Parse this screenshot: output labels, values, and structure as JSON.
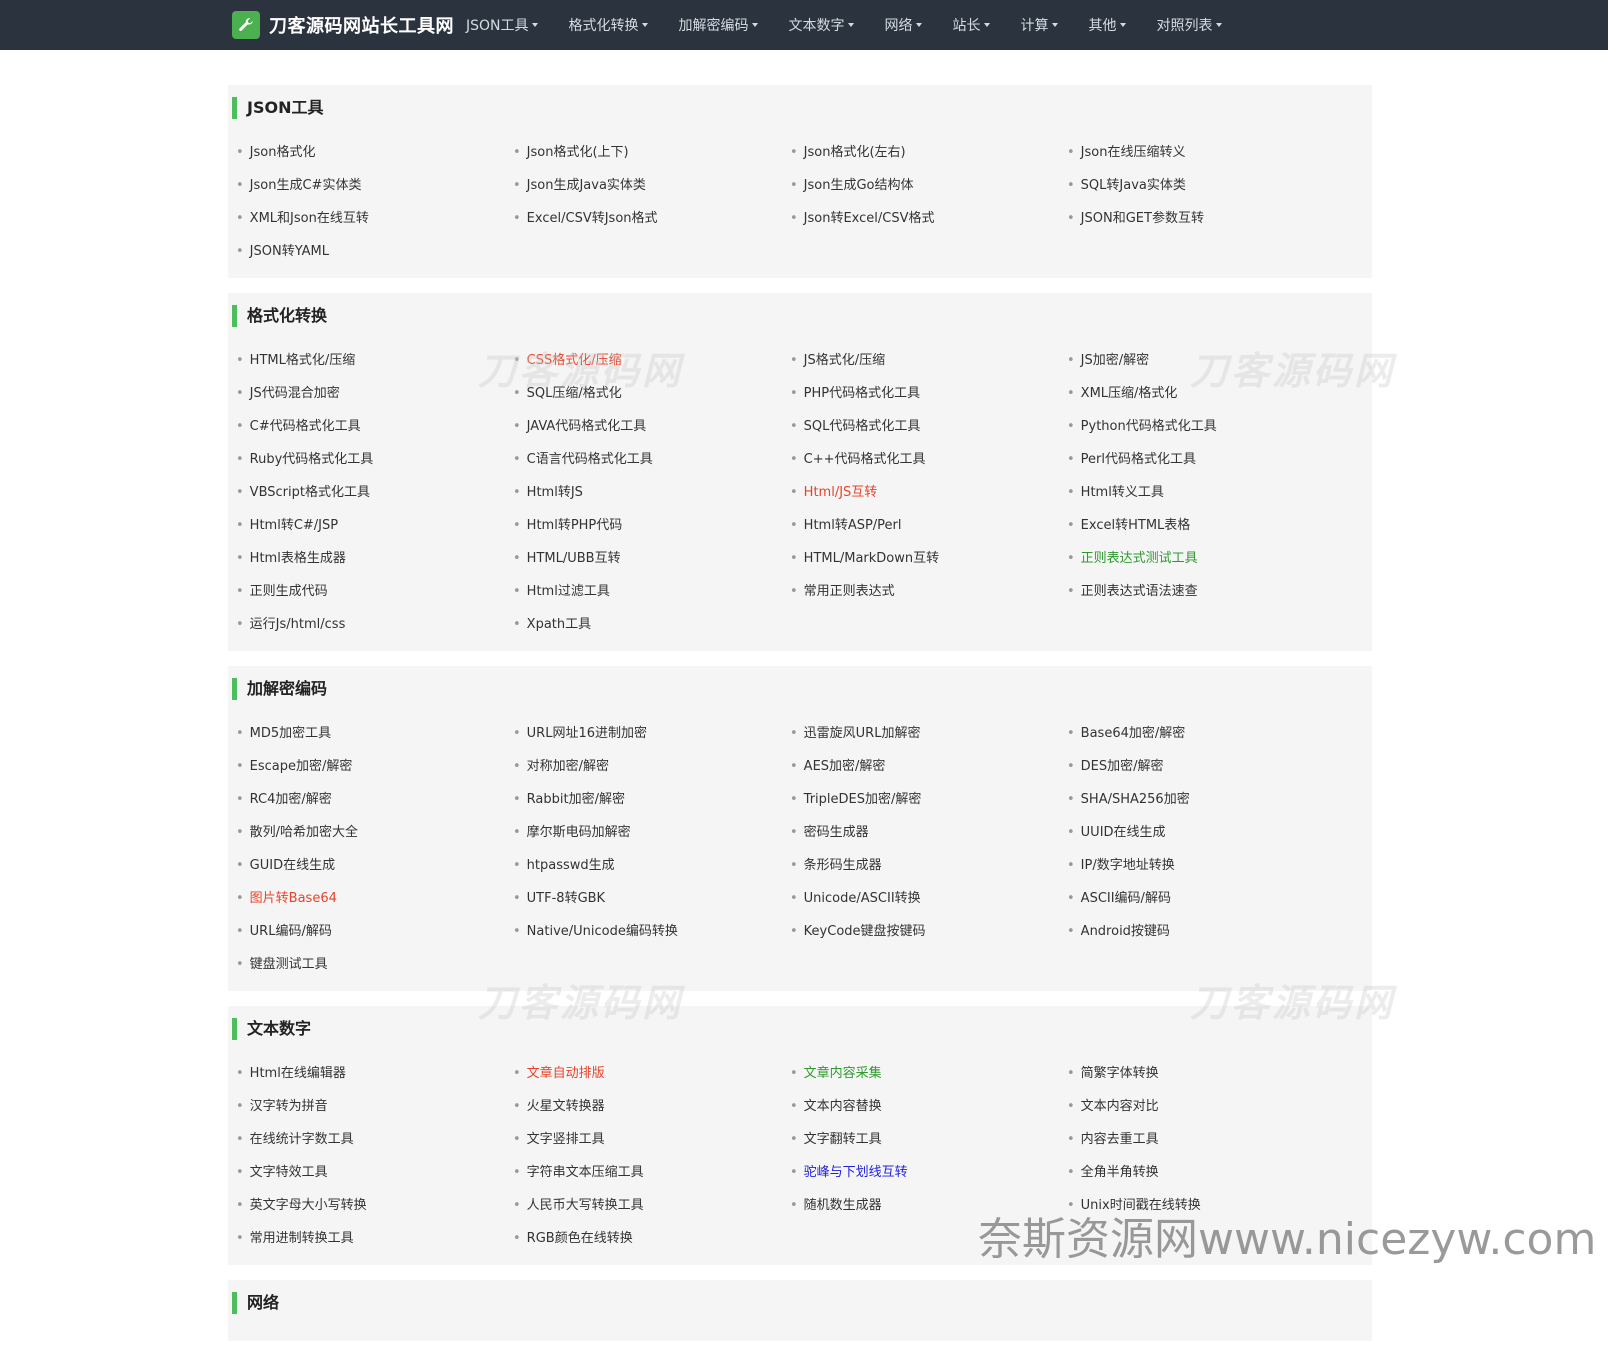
{
  "brand": {
    "name": "刀客源码网站长工具网",
    "icon": "wrench-icon"
  },
  "nav": [
    {
      "label": "JSON工具"
    },
    {
      "label": "格式化转换"
    },
    {
      "label": "加解密编码"
    },
    {
      "label": "文本数字"
    },
    {
      "label": "网络"
    },
    {
      "label": "站长"
    },
    {
      "label": "计算"
    },
    {
      "label": "其他"
    },
    {
      "label": "对照列表"
    }
  ],
  "colors": {
    "accent": "#4cbe5c",
    "navbar": "#2b333f",
    "red": "#e8432a",
    "green": "#2e9a2e",
    "blue": "#2222dd"
  },
  "sections": [
    {
      "title": "JSON工具",
      "items": [
        {
          "label": "Json格式化"
        },
        {
          "label": "Json格式化(上下)"
        },
        {
          "label": "Json格式化(左右)"
        },
        {
          "label": "Json在线压缩转义"
        },
        {
          "label": "Json生成C#实体类"
        },
        {
          "label": "Json生成Java实体类"
        },
        {
          "label": "Json生成Go结构体"
        },
        {
          "label": "SQL转Java实体类"
        },
        {
          "label": "XML和Json在线互转"
        },
        {
          "label": "Excel/CSV转Json格式"
        },
        {
          "label": "Json转Excel/CSV格式"
        },
        {
          "label": "JSON和GET参数互转"
        },
        {
          "label": "JSON转YAML"
        }
      ]
    },
    {
      "title": "格式化转换",
      "items": [
        {
          "label": "HTML格式化/压缩"
        },
        {
          "label": "CSS格式化/压缩",
          "color": "red"
        },
        {
          "label": "JS格式化/压缩"
        },
        {
          "label": "JS加密/解密"
        },
        {
          "label": "JS代码混合加密"
        },
        {
          "label": "SQL压缩/格式化"
        },
        {
          "label": "PHP代码格式化工具"
        },
        {
          "label": "XML压缩/格式化"
        },
        {
          "label": "C#代码格式化工具"
        },
        {
          "label": "JAVA代码格式化工具"
        },
        {
          "label": "SQL代码格式化工具"
        },
        {
          "label": "Python代码格式化工具"
        },
        {
          "label": "Ruby代码格式化工具"
        },
        {
          "label": "C语言代码格式化工具"
        },
        {
          "label": "C++代码格式化工具"
        },
        {
          "label": "Perl代码格式化工具"
        },
        {
          "label": "VBScript格式化工具"
        },
        {
          "label": "Html转JS"
        },
        {
          "label": "Html/JS互转",
          "color": "red"
        },
        {
          "label": "Html转义工具"
        },
        {
          "label": "Html转C#/JSP"
        },
        {
          "label": "Html转PHP代码"
        },
        {
          "label": "Html转ASP/Perl"
        },
        {
          "label": "Excel转HTML表格"
        },
        {
          "label": "Html表格生成器"
        },
        {
          "label": "HTML/UBB互转"
        },
        {
          "label": "HTML/MarkDown互转"
        },
        {
          "label": "正则表达式测试工具",
          "color": "green"
        },
        {
          "label": "正则生成代码"
        },
        {
          "label": "Html过滤工具"
        },
        {
          "label": "常用正则表达式"
        },
        {
          "label": "正则表达式语法速查"
        },
        {
          "label": "运行Js/html/css"
        },
        {
          "label": "Xpath工具"
        }
      ]
    },
    {
      "title": "加解密编码",
      "items": [
        {
          "label": "MD5加密工具"
        },
        {
          "label": "URL网址16进制加密"
        },
        {
          "label": "迅雷旋风URL加解密"
        },
        {
          "label": "Base64加密/解密"
        },
        {
          "label": "Escape加密/解密"
        },
        {
          "label": "对称加密/解密"
        },
        {
          "label": "AES加密/解密"
        },
        {
          "label": "DES加密/解密"
        },
        {
          "label": "RC4加密/解密"
        },
        {
          "label": "Rabbit加密/解密"
        },
        {
          "label": "TripleDES加密/解密"
        },
        {
          "label": "SHA/SHA256加密"
        },
        {
          "label": "散列/哈希加密大全"
        },
        {
          "label": "摩尔斯电码加解密"
        },
        {
          "label": "密码生成器"
        },
        {
          "label": "UUID在线生成"
        },
        {
          "label": "GUID在线生成"
        },
        {
          "label": "htpasswd生成"
        },
        {
          "label": "条形码生成器"
        },
        {
          "label": "IP/数字地址转换"
        },
        {
          "label": "图片转Base64",
          "color": "red"
        },
        {
          "label": "UTF-8转GBK"
        },
        {
          "label": "Unicode/ASCII转换"
        },
        {
          "label": "ASCII编码/解码"
        },
        {
          "label": "URL编码/解码"
        },
        {
          "label": "Native/Unicode编码转换"
        },
        {
          "label": "KeyCode键盘按键码"
        },
        {
          "label": "Android按键码"
        },
        {
          "label": "键盘测试工具"
        }
      ]
    },
    {
      "title": "文本数字",
      "items": [
        {
          "label": "Html在线编辑器"
        },
        {
          "label": "文章自动排版",
          "color": "red"
        },
        {
          "label": "文章内容采集",
          "color": "green"
        },
        {
          "label": "简繁字体转换"
        },
        {
          "label": "汉字转为拼音"
        },
        {
          "label": "火星文转换器"
        },
        {
          "label": "文本内容替换"
        },
        {
          "label": "文本内容对比"
        },
        {
          "label": "在线统计字数工具"
        },
        {
          "label": "文字竖排工具"
        },
        {
          "label": "文字翻转工具"
        },
        {
          "label": "内容去重工具"
        },
        {
          "label": "文字特效工具"
        },
        {
          "label": "字符串文本压缩工具"
        },
        {
          "label": "驼峰与下划线互转",
          "color": "blue"
        },
        {
          "label": "全角半角转换"
        },
        {
          "label": "英文字母大小写转换"
        },
        {
          "label": "人民币大写转换工具"
        },
        {
          "label": "随机数生成器"
        },
        {
          "label": "Unix时间戳在线转换"
        },
        {
          "label": "常用进制转换工具"
        },
        {
          "label": "RGB颜色在线转换"
        }
      ]
    },
    {
      "title": "网络",
      "items": []
    }
  ],
  "watermarks": {
    "logo_text": "刀客源码网",
    "bottom_text": "奈斯资源网www.nicezyw.com"
  }
}
